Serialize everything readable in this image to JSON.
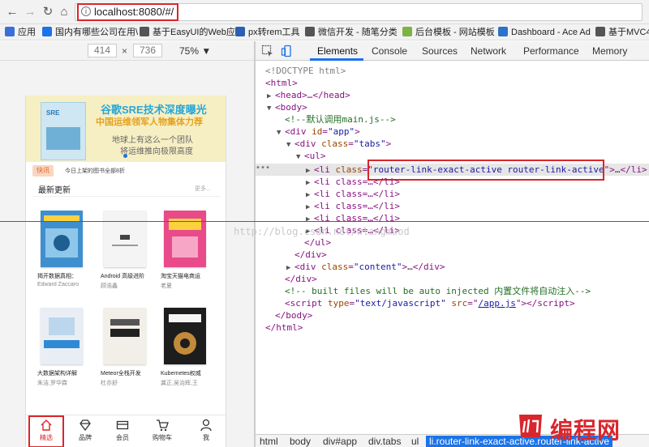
{
  "browser": {
    "url": "localhost:8080/#/",
    "bookmarks": [
      {
        "label": "应用",
        "color": "#3b6fd8"
      },
      {
        "label": "国内有哪些公司在用\\",
        "color": "#1a73e8"
      },
      {
        "label": "基于EasyUI的Web应",
        "color": "#555555"
      },
      {
        "label": "px转rem工具",
        "color": "#2b5fb3"
      },
      {
        "label": "微信开发 - 随笔分类",
        "color": "#555555"
      },
      {
        "label": "后台模板 - 网站模板",
        "color": "#7cb342"
      },
      {
        "label": "Dashboard - Ace Ad",
        "color": "#2a73c9"
      },
      {
        "label": "基于MVC4+",
        "color": "#555555"
      }
    ]
  },
  "device": {
    "width": "414",
    "height": "736",
    "zoom": "75%",
    "zoom_arrow": "▼",
    "times": "×"
  },
  "phone": {
    "banner": {
      "line1": "谷歌SRE技术深度曝光",
      "line2": "中国运维领军人物集体力荐",
      "line3": "地球上有这么一个团队",
      "line4": "将运维推向极限高度",
      "book_label": "SRE"
    },
    "notice": {
      "badge": "快讯",
      "text": "今日上架的图书全部8折"
    },
    "section": {
      "title": "最新更新",
      "more": "更多..."
    },
    "books": [
      {
        "title": "揭开数据真相：",
        "author": "Edward Zaccaro",
        "color": "#3f8fcf"
      },
      {
        "title": "Android 高级进阶",
        "author": "顾浩鑫",
        "color": "#f4f4f4"
      },
      {
        "title": "淘宝天猫电商运",
        "author": "老夏",
        "color": "#e84a8a"
      },
      {
        "title": "大数据架构详解",
        "author": "朱洁,罗华霖",
        "color": "#e9eef4"
      },
      {
        "title": "Meteor全栈开发",
        "author": "杜亦舒",
        "color": "#f2efe8"
      },
      {
        "title": "Kubernetes权威",
        "author": "龚正,吴治辉,王",
        "color": "#1d1d1d"
      }
    ],
    "tabs": [
      {
        "label": "精选",
        "icon": "home-icon"
      },
      {
        "label": "品牌",
        "icon": "diamond-icon"
      },
      {
        "label": "会员",
        "icon": "card-icon"
      },
      {
        "label": "购物车",
        "icon": "cart-icon"
      },
      {
        "label": "我",
        "icon": "user-icon"
      }
    ]
  },
  "devtools": {
    "tabs": [
      "Elements",
      "Console",
      "Sources",
      "Network",
      "Performance",
      "Memory"
    ],
    "active_tab": "Elements",
    "dom": {
      "doctype": "<!DOCTYPE html>",
      "html_open": "<html>",
      "head": "<head>…</head>",
      "body_open": "<body>",
      "comment1": "<!--默认调用main.js-->",
      "div_app_tag": "div",
      "div_app_attr": "id",
      "div_app_val": "\"app\"",
      "div_tabs_tag": "div",
      "div_tabs_attr": "class",
      "div_tabs_val": "\"tabs\"",
      "ul_open": "<ul>",
      "li_selected_attr": "class",
      "li_selected_val": "router-link-exact-active router-link-active",
      "li_collapsed": "<li class=…</li>",
      "ul_close": "</ul>",
      "div_close": "</div>",
      "div_content_val": "\"content\"",
      "comment2": "<!-- built files will be auto injected 内置文件将自动注入-->",
      "script_type": "\"text/javascript\"",
      "script_src": "/app.js",
      "body_close": "</body>",
      "html_close": "</html>",
      "ellipsis": "…",
      "dots": "•••"
    },
    "breadcrumbs": [
      "html",
      "body",
      "div#app",
      "div.tabs",
      "ul",
      "li.router-link-exact-active.router-link-active"
    ]
  },
  "overlay": {
    "watermark": "http://blog.csdn.net/wlangmood",
    "logo_text": "编程网"
  }
}
